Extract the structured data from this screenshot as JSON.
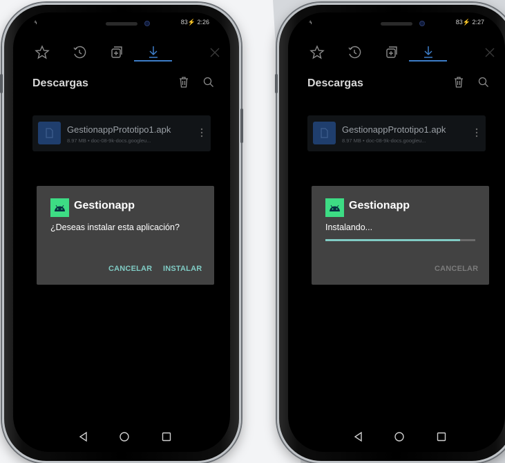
{
  "phones": [
    {
      "status": {
        "signal": "⁴ₗₗ",
        "battery": "83",
        "time": "2:26"
      },
      "tabs": [
        "bookmarks-tab",
        "history-tab",
        "tabs-tab",
        "downloads-tab"
      ],
      "page_title": "Descargas",
      "file": {
        "name": "GestionappPrototipo1.apk",
        "meta": "8.97 MB • doc-08-9k-docs.googleu..."
      },
      "dialog": {
        "app_name": "Gestionapp",
        "message": "¿Deseas instalar esta aplicación?",
        "cancel_label": "CANCELAR",
        "install_label": "INSTALAR"
      }
    },
    {
      "status": {
        "signal": "⁴ₗₗ",
        "battery": "83",
        "time": "2:27"
      },
      "tabs": [
        "bookmarks-tab",
        "history-tab",
        "tabs-tab",
        "downloads-tab"
      ],
      "page_title": "Descargas",
      "file": {
        "name": "GestionappPrototipo1.apk",
        "meta": "8.97 MB • doc-08-9k-docs.googleu..."
      },
      "dialog": {
        "app_name": "Gestionapp",
        "message": "Instalando...",
        "progress": 0.9,
        "cancel_label": "CANCELAR"
      }
    }
  ],
  "colors": {
    "accent": "#80cbc4",
    "dialog_bg": "#424242",
    "tab_active": "#3e7ec9",
    "file_icon": "#1f3e6d",
    "android_green": "#3ddc84"
  }
}
